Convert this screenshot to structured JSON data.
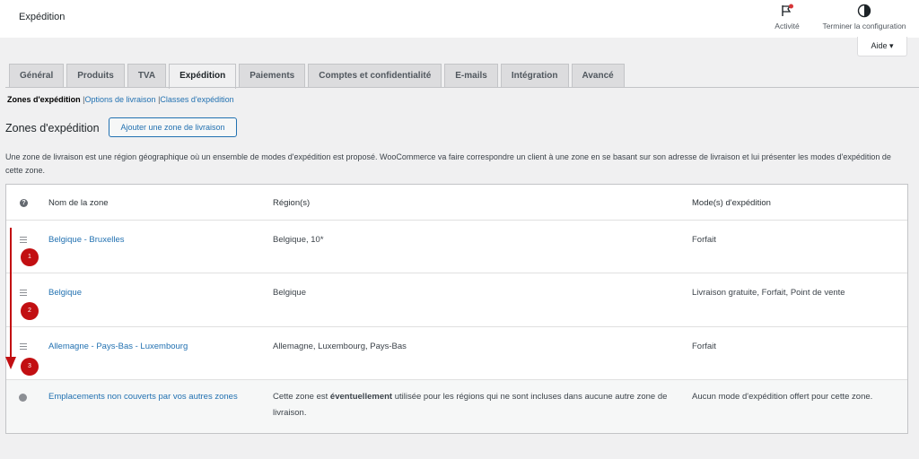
{
  "header": {
    "title": "Expédition",
    "activity_label": "Activité",
    "finish_label": "Terminer la configuration",
    "help_label": "Aide ▾"
  },
  "tabs": [
    {
      "label": "Général"
    },
    {
      "label": "Produits"
    },
    {
      "label": "TVA"
    },
    {
      "label": "Expédition",
      "active": true
    },
    {
      "label": "Paiements"
    },
    {
      "label": "Comptes et confidentialité"
    },
    {
      "label": "E-mails"
    },
    {
      "label": "Intégration"
    },
    {
      "label": "Avancé"
    }
  ],
  "subnav": {
    "current": "Zones d'expédition",
    "links": [
      "Options de livraison",
      "Classes d'expédition"
    ],
    "sep": "|"
  },
  "section": {
    "title": "Zones d'expédition",
    "add_button": "Ajouter une zone de livraison",
    "description": "Une zone de livraison est une région géographique où un ensemble de modes d'expédition est proposé. WooCommerce va faire correspondre un client à une zone en se basant sur son adresse de livraison et lui présenter les modes d'expédition de cette zone."
  },
  "table": {
    "help_icon": "?",
    "columns": {
      "name": "Nom de la zone",
      "region": "Région(s)",
      "method": "Mode(s) d'expédition"
    },
    "rows": [
      {
        "name": "Belgique - Bruxelles",
        "region": "Belgique, 10*",
        "method": "Forfait",
        "badge": "1"
      },
      {
        "name": "Belgique",
        "region": "Belgique",
        "method": "Livraison gratuite, Forfait, Point de vente",
        "badge": "2"
      },
      {
        "name": "Allemagne - Pays-Bas - Luxembourg",
        "region": "Allemagne, Luxembourg, Pays-Bas",
        "method": "Forfait",
        "badge": "3"
      }
    ],
    "rest": {
      "name": "Emplacements non couverts par vos autres zones",
      "region_pre": "Cette zone est ",
      "region_bold": "éventuellement",
      "region_post": " utilisée pour les régions qui ne sont incluses dans aucune autre zone de livraison.",
      "method": "Aucun mode d'expédition offert pour cette zone."
    }
  },
  "colors": {
    "accent": "#2271b1",
    "annotation": "#c20f12"
  },
  "icons": {
    "activity": "flag-icon",
    "finish": "half-circle-icon",
    "handle": "drag-handle-icon",
    "globe": "globe-icon",
    "help": "help-icon"
  }
}
